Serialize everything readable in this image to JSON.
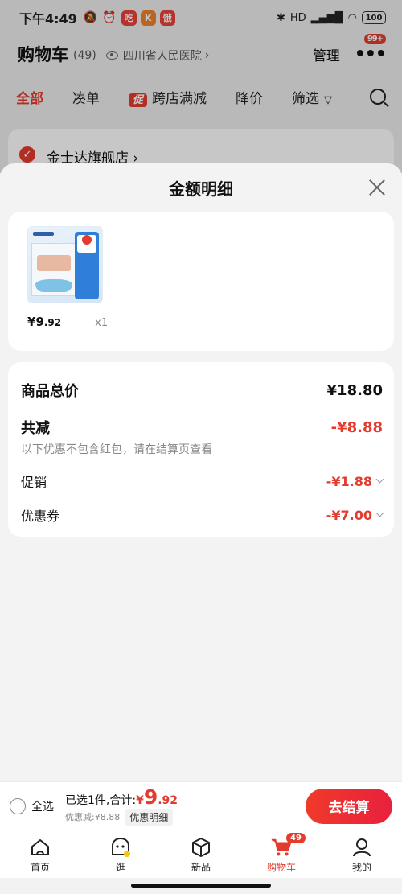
{
  "status_bar": {
    "time": "下午4:49",
    "app_badges": [
      "吃",
      "K",
      "饿"
    ],
    "network": "HD",
    "battery": "100"
  },
  "cart": {
    "title": "购物车",
    "count": "(49)",
    "location": "四川省人民医院",
    "manage_label": "管理",
    "more_badge": "99+",
    "tabs": [
      "全部",
      "凑单",
      "跨店满减",
      "降价",
      "筛选"
    ],
    "promo_tag": "促",
    "store_name": "金士达旗舰店"
  },
  "sheet": {
    "title": "金额明细",
    "product": {
      "price_symbol": "¥",
      "price_int": "9",
      "price_dec": ".92",
      "quantity": "x1"
    },
    "total_label": "商品总价",
    "total_value": "¥18.80",
    "discount_label": "共减",
    "discount_value": "-¥8.88",
    "note": "以下优惠不包含红包，请在结算页查看",
    "rows": [
      {
        "label": "促销",
        "value": "-¥1.88"
      },
      {
        "label": "优惠券",
        "value": "-¥7.00"
      }
    ]
  },
  "checkout": {
    "select_all": "全选",
    "selected_text": "已选1件,合计:",
    "price_symbol": "¥",
    "price_int": "9",
    "price_dec": ".92",
    "discount_text": "优惠减:¥8.88",
    "detail_tag": "优惠明细",
    "button": "去结算"
  },
  "tab_bar": {
    "tabs": [
      {
        "label": "首页",
        "icon": "home-icon"
      },
      {
        "label": "逛",
        "icon": "explore-icon"
      },
      {
        "label": "新品",
        "icon": "new-products-icon"
      },
      {
        "label": "购物车",
        "icon": "cart-icon"
      },
      {
        "label": "我的",
        "icon": "profile-icon"
      }
    ],
    "cart_badge": "49"
  },
  "colors": {
    "accent": "#e33b2e",
    "sheet_bg": "#f3f3f3",
    "card_bg": "#ffffff"
  }
}
